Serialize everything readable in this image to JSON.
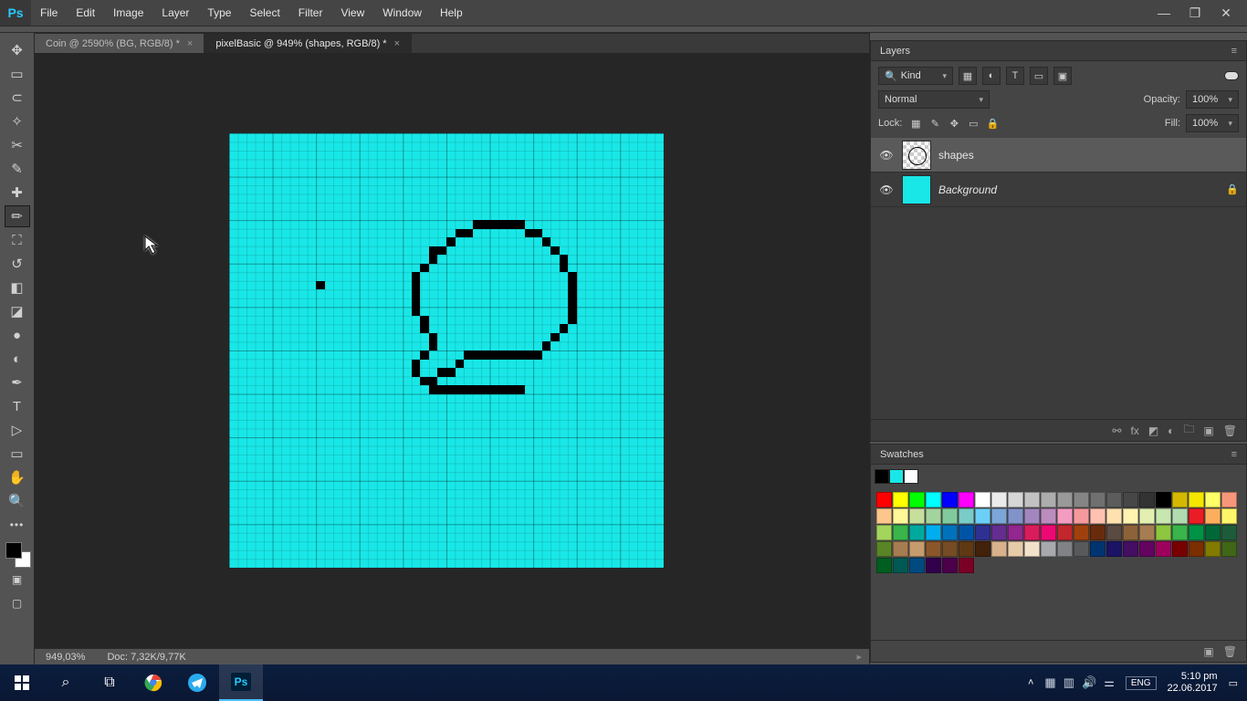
{
  "menu": [
    "File",
    "Edit",
    "Image",
    "Layer",
    "Type",
    "Select",
    "Filter",
    "View",
    "Window",
    "Help"
  ],
  "tabs": [
    {
      "label": "Coin @ 2590% (BG, RGB/8) *",
      "active": false
    },
    {
      "label": "pixelBasic @ 949% (shapes, RGB/8) *",
      "active": true
    }
  ],
  "status": {
    "zoom": "949,03%",
    "doc": "Doc: 7,32K/9,77K"
  },
  "layers_panel": {
    "title": "Layers",
    "filter": "Kind",
    "blend": "Normal",
    "opacity_label": "Opacity:",
    "opacity": "100%",
    "lock_label": "Lock:",
    "fill_label": "Fill:",
    "fill": "100%",
    "layers": [
      {
        "name": "shapes",
        "locked": false,
        "sel": true,
        "bg": false
      },
      {
        "name": "Background",
        "locked": true,
        "sel": false,
        "bg": true
      }
    ]
  },
  "swatches_panel": {
    "title": "Swatches",
    "top3": [
      "#000000",
      "#19e7e7",
      "#ffffff"
    ],
    "colors": [
      "#ff0000",
      "#ffff00",
      "#00ff00",
      "#00ffff",
      "#0000ff",
      "#ff00ff",
      "#ffffff",
      "#ebebeb",
      "#d6d6d6",
      "#c2c2c2",
      "#adadad",
      "#999999",
      "#858585",
      "#707070",
      "#5c5c5c",
      "#474747",
      "#333333",
      "#000000",
      "#d4b800",
      "#f5e600",
      "#ffff66",
      "#f7977a",
      "#fdc68c",
      "#fff799",
      "#c6df9c",
      "#a4d49d",
      "#81ca9d",
      "#7accc8",
      "#6ccff7",
      "#7ca6d8",
      "#8293ca",
      "#a286bd",
      "#bc8cbf",
      "#f49bc1",
      "#f5999d",
      "#ffc2b0",
      "#ffe1b0",
      "#fff3b0",
      "#e2efb0",
      "#c8e6b0",
      "#b0dcb0",
      "#ec1c24",
      "#fbaf5d",
      "#fff568",
      "#a3d55d",
      "#39b54a",
      "#00a99e",
      "#00aeef",
      "#0072bc",
      "#0054a6",
      "#2e3192",
      "#652d90",
      "#91278f",
      "#da1c5c",
      "#ed0973",
      "#c1272d",
      "#a0410d",
      "#682c0d",
      "#594a42",
      "#8c6239",
      "#a67c52",
      "#8dc63f",
      "#39b54a",
      "#009245",
      "#006837",
      "#1d5c3a",
      "#598527",
      "#a67c52",
      "#c69c6d",
      "#8b572a",
      "#754c24",
      "#603913",
      "#42210b",
      "#d9b28b",
      "#e6cba8",
      "#f2e2c9",
      "#a7a9ac",
      "#808285",
      "#58595b",
      "#003471",
      "#1b1464",
      "#440e62",
      "#630460",
      "#9e005d",
      "#790000",
      "#7b2e00",
      "#827b00",
      "#406618",
      "#005e20",
      "#005952",
      "#004a80",
      "#32004b",
      "#4b0049",
      "#7a0026"
    ]
  },
  "taskbar": {
    "time": "5:10 pm",
    "date": "22.06.2017",
    "lang": "ENG"
  }
}
